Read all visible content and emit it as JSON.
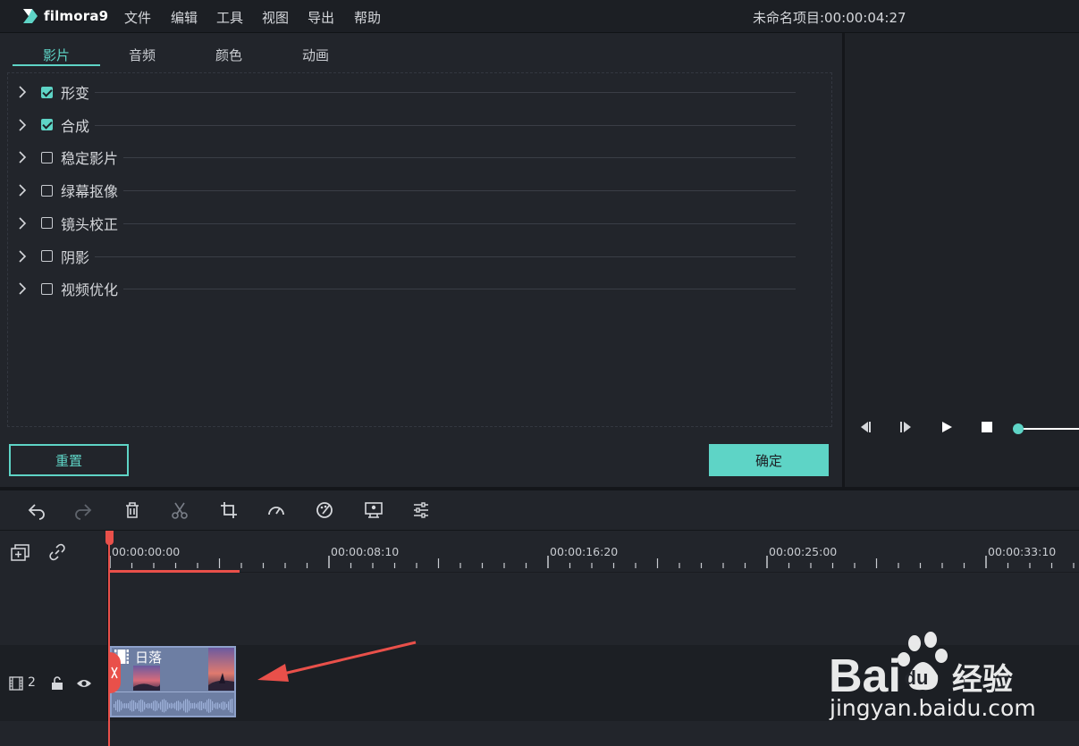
{
  "app": {
    "logo_text": "filmora9",
    "project_title": "未命名项目:00:00:04:27"
  },
  "menu": [
    "文件",
    "编辑",
    "工具",
    "视图",
    "导出",
    "帮助"
  ],
  "tabs": [
    "影片",
    "音频",
    "颜色",
    "动画"
  ],
  "active_tab": "影片",
  "effects": [
    {
      "label": "形变",
      "checked": true
    },
    {
      "label": "合成",
      "checked": true
    },
    {
      "label": "稳定影片",
      "checked": false
    },
    {
      "label": "绿幕抠像",
      "checked": false
    },
    {
      "label": "镜头校正",
      "checked": false
    },
    {
      "label": "阴影",
      "checked": false
    },
    {
      "label": "视频优化",
      "checked": false
    }
  ],
  "buttons": {
    "reset": "重置",
    "ok": "确定"
  },
  "timeline": {
    "ruler_labels": [
      "00:00:00:00",
      "00:00:08:10",
      "00:00:16:20",
      "00:00:25:00",
      "00:00:33:10"
    ],
    "track_number": "2",
    "clip_title": "日落"
  },
  "watermark": {
    "brand": "Bai",
    "brand2": "经验",
    "url": "jingyan.baidu.com"
  },
  "colors": {
    "accent": "#5ed4c6",
    "playhead": "#e9504a",
    "clip": "#6d7ea3"
  }
}
